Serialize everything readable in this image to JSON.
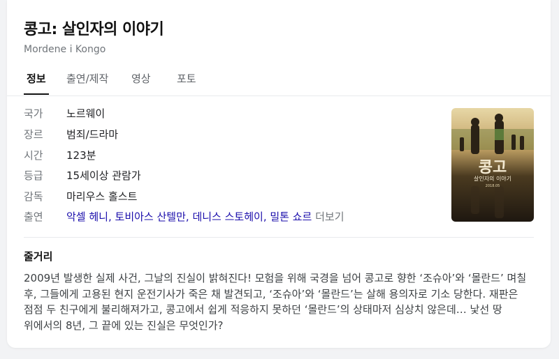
{
  "movie": {
    "title": "콩고: 살인자의 이야기",
    "original_title": "Mordene i Kongo"
  },
  "tabs": [
    {
      "label": "정보",
      "active": true
    },
    {
      "label": "출연/제작",
      "active": false
    },
    {
      "label": "영상",
      "active": false
    },
    {
      "label": "포토",
      "active": false
    }
  ],
  "info": {
    "country": {
      "label": "국가",
      "value": "노르웨이"
    },
    "genre": {
      "label": "장르",
      "value": "범죄/드라마"
    },
    "runtime": {
      "label": "시간",
      "value": "123분"
    },
    "rating": {
      "label": "등급",
      "value": "15세이상 관람가"
    },
    "director": {
      "label": "감독",
      "value": "마리우스 홀스트"
    },
    "cast": {
      "label": "출연",
      "names": [
        "악셀 헤니",
        "토비아스 산텔만",
        "데니스 스토헤이",
        "밀톤 쇼르"
      ],
      "separator": ", ",
      "more": "더보기"
    }
  },
  "poster": {
    "title_text": "콩고",
    "subtitle_text": "살인자의 이야기",
    "date_text": "2018.05"
  },
  "synopsis": {
    "heading": "줄거리",
    "text": "2009년 발생한 실제 사건, 그날의 진실이 밝혀진다! 모험을 위해 국경을 넘어 콩고로 향한 ‘조슈아’와 ‘몰란드’ 며칠 후, 그들에게 고용된 현지 운전기사가 죽은 채 발견되고, ‘조슈아’와 ‘몰란드’는 살해 용의자로 기소 당한다. 재판은 점점 두 친구에게 불리해져가고, 콩고에서 쉽게 적응하지 못하던 ‘몰란드’의 상태마저 심상치 않은데… 낯선 땅 위에서의 8년, 그 끝에 있는 진실은 무엇인가?"
  }
}
